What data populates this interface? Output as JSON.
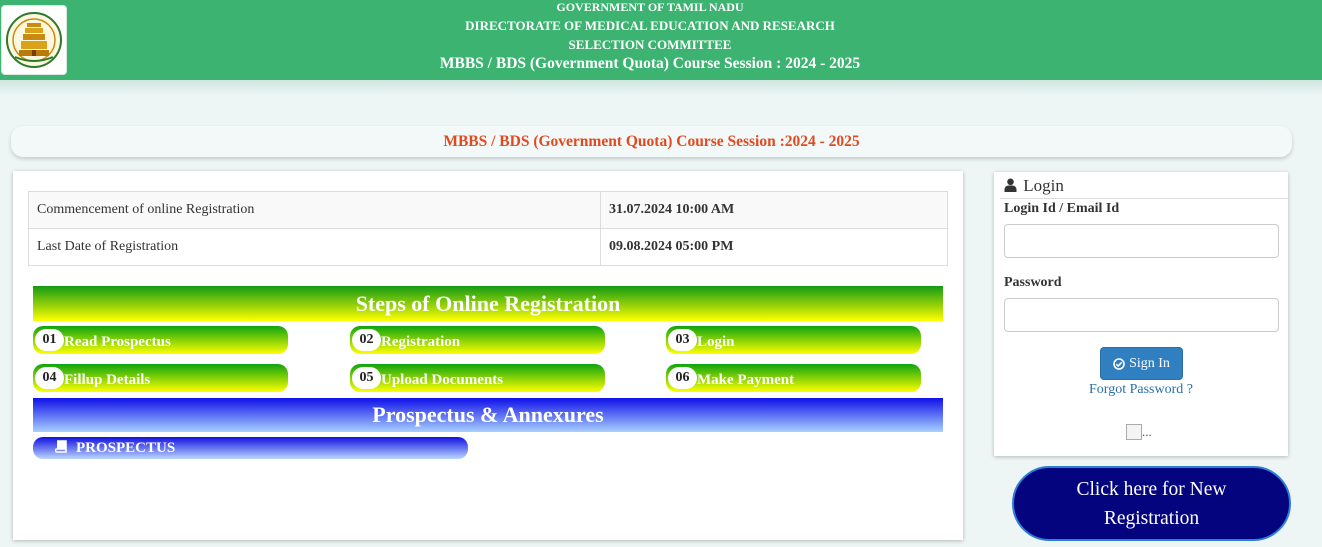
{
  "header": {
    "line1": "GOVERNMENT OF TAMIL NADU",
    "line2": "DIRECTORATE OF MEDICAL EDUCATION AND RESEARCH",
    "line3": "SELECTION COMMITTEE",
    "line4": "MBBS / BDS (Government Quota) Course Session : 2024 - 2025",
    "logo_icon": "tamil-nadu-emblem-icon"
  },
  "banner": {
    "text": "MBBS / BDS (Government Quota) Course Session :2024 - 2025"
  },
  "dates": [
    {
      "label": "Commencement of online Registration",
      "value": "31.07.2024 10:00 AM"
    },
    {
      "label": "Last Date of Registration",
      "value": "09.08.2024 05:00 PM"
    }
  ],
  "steps": {
    "title": "Steps of Online Registration",
    "items": [
      {
        "num": "01",
        "label": "Read Prospectus"
      },
      {
        "num": "02",
        "label": "Registration"
      },
      {
        "num": "03",
        "label": "Login"
      },
      {
        "num": "04",
        "label": "Fillup Details"
      },
      {
        "num": "05",
        "label": "Upload Documents"
      },
      {
        "num": "06",
        "label": "Make Payment"
      }
    ]
  },
  "prospectus": {
    "title": "Prospectus & Annexures",
    "button_label": "PROSPECTUS",
    "button_icon": "book-icon"
  },
  "login": {
    "title": "Login",
    "title_icon": "user-icon",
    "id_label": "Login Id / Email Id",
    "id_value": "",
    "password_label": "Password",
    "password_value": "",
    "signin_label": "Sign In",
    "signin_icon": "check-circle-icon",
    "forgot_label": "Forgot Password ?",
    "broken_image_alt": "..."
  },
  "new_registration": {
    "label": "Click here for New Registration"
  },
  "colors": {
    "header_bg": "#3cb371",
    "banner_text": "#e24a1d",
    "steps_gradient_start": "#0ea40e",
    "steps_gradient_end": "#ffff00",
    "prospectus_gradient_start": "#1010e8",
    "new_registration_bg": "#04047f",
    "signin_bg": "#2f7fc1"
  }
}
